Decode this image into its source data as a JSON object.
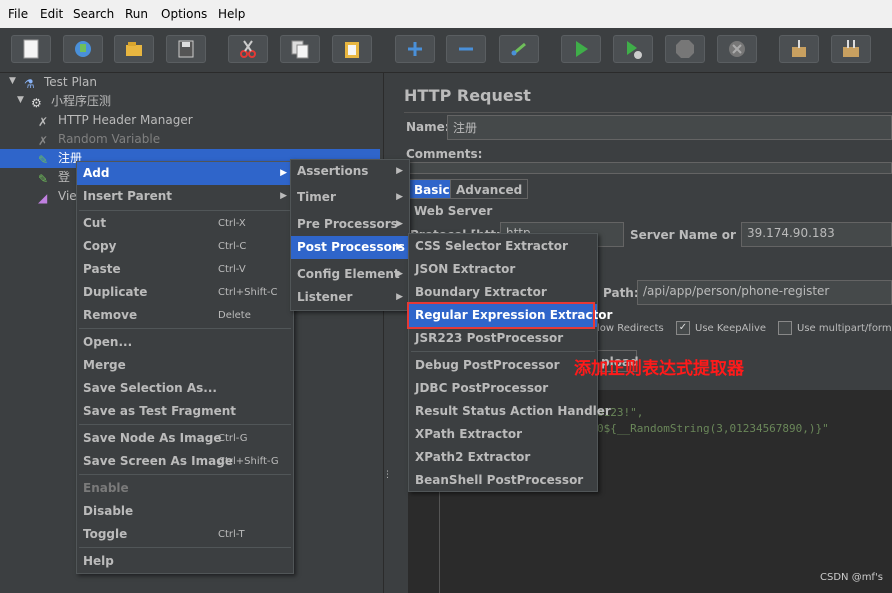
{
  "menubar": {
    "items": [
      "File",
      "Edit",
      "Search",
      "Run",
      "Options",
      "Help"
    ]
  },
  "toolbar": {
    "buttons": [
      "new-icon",
      "templates-icon",
      "open-icon",
      "save-icon",
      "cut-icon",
      "copy-icon",
      "paste-icon",
      "expand-icon",
      "collapse-icon",
      "toggle-icon",
      "start-icon",
      "start-no-pause-icon",
      "stop-icon",
      "shutdown-icon",
      "clear-icon",
      "clear-all-icon"
    ]
  },
  "tree": {
    "items": [
      {
        "label": "Test Plan"
      },
      {
        "label": "小程序压测"
      },
      {
        "label": "HTTP Header Manager"
      },
      {
        "label": "Random Variable"
      },
      {
        "label": "注册"
      },
      {
        "label": "登"
      },
      {
        "label": "Vie"
      }
    ]
  },
  "panel": {
    "title": "HTTP Request",
    "name_label": "Name:",
    "name_value": "注册",
    "comments_label": "Comments:",
    "tabs": [
      "Basic",
      "Advanced"
    ],
    "web_server_label": "Web Server",
    "protocol_label": "Protocol [http]:",
    "protocol_value": "http",
    "server_label": "Server Name or IP:",
    "server_value": "39.174.90.183",
    "path_label": "Path:",
    "path_value": "/api/app/person/phone-register",
    "redirects_label": "low Redirects",
    "keepalive_label": "Use KeepAlive",
    "multipart_label": "Use multipart/form-d",
    "upload_tab": "pload",
    "code_line1": "o123!\",",
    "code_line2": "0${__RandomString(3,01234567890,)}\""
  },
  "context_menu": {
    "items": [
      {
        "label": "Add",
        "shortcut": "",
        "submenu": true
      },
      {
        "label": "Insert Parent",
        "shortcut": "",
        "submenu": true
      },
      {
        "label": "Cut",
        "shortcut": "Ctrl-X"
      },
      {
        "label": "Copy",
        "shortcut": "Ctrl-C"
      },
      {
        "label": "Paste",
        "shortcut": "Ctrl-V"
      },
      {
        "label": "Duplicate",
        "shortcut": "Ctrl+Shift-C"
      },
      {
        "label": "Remove",
        "shortcut": "Delete"
      },
      {
        "label": "Open..."
      },
      {
        "label": "Merge"
      },
      {
        "label": "Save Selection As..."
      },
      {
        "label": "Save as Test Fragment"
      },
      {
        "label": "Save Node As Image",
        "shortcut": "Ctrl-G"
      },
      {
        "label": "Save Screen As Image",
        "shortcut": "Ctrl+Shift-G"
      },
      {
        "label": "Enable"
      },
      {
        "label": "Disable"
      },
      {
        "label": "Toggle",
        "shortcut": "Ctrl-T"
      },
      {
        "label": "Help"
      }
    ]
  },
  "add_menu": {
    "items": [
      "Assertions",
      "Timer",
      "Pre Processors",
      "Post Processors",
      "Config Element",
      "Listener"
    ]
  },
  "post_menu": {
    "items": [
      "CSS Selector Extractor",
      "JSON Extractor",
      "Boundary Extractor",
      "Regular Expression Extractor",
      "JSR223 PostProcessor",
      "Debug PostProcessor",
      "JDBC PostProcessor",
      "Result Status Action Handler",
      "XPath Extractor",
      "XPath2 Extractor",
      "BeanShell PostProcessor"
    ]
  },
  "annotation": "添加正则表达式提取器",
  "watermark": "CSDN @mf's",
  "colors": {
    "selection": "#2f65ca",
    "background": "#3c3f41",
    "annotation": "#ff1a1a"
  }
}
